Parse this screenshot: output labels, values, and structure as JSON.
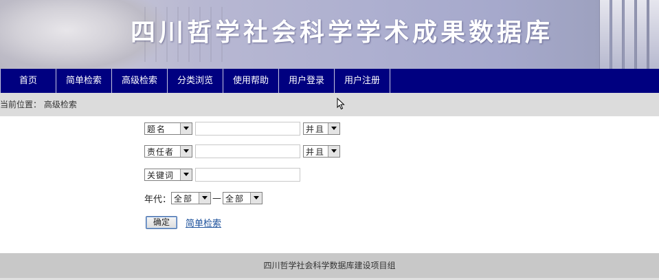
{
  "banner": {
    "title": "四川哲学社会科学学术成果数据库"
  },
  "nav": {
    "items": [
      {
        "label": "首页"
      },
      {
        "label": "简单检索"
      },
      {
        "label": "高级检索"
      },
      {
        "label": "分类浏览"
      },
      {
        "label": "使用帮助"
      },
      {
        "label": "用户登录"
      },
      {
        "label": "用户注册"
      }
    ],
    "background": "#000080"
  },
  "breadcrumb": {
    "prefix": "当前位置：",
    "current": "高级检索"
  },
  "form": {
    "rows": [
      {
        "field": "题名",
        "value": "",
        "logic": "并且"
      },
      {
        "field": "责任者",
        "value": "",
        "logic": "并且"
      },
      {
        "field": "关键词",
        "value": ""
      }
    ],
    "year": {
      "label": "年代：",
      "from": "全部",
      "separator": "—",
      "to": "全部"
    },
    "submit_label": "确定",
    "simple_link": "简单检索"
  },
  "footer": {
    "text": "四川哲学社会科学数据库建设项目组"
  }
}
